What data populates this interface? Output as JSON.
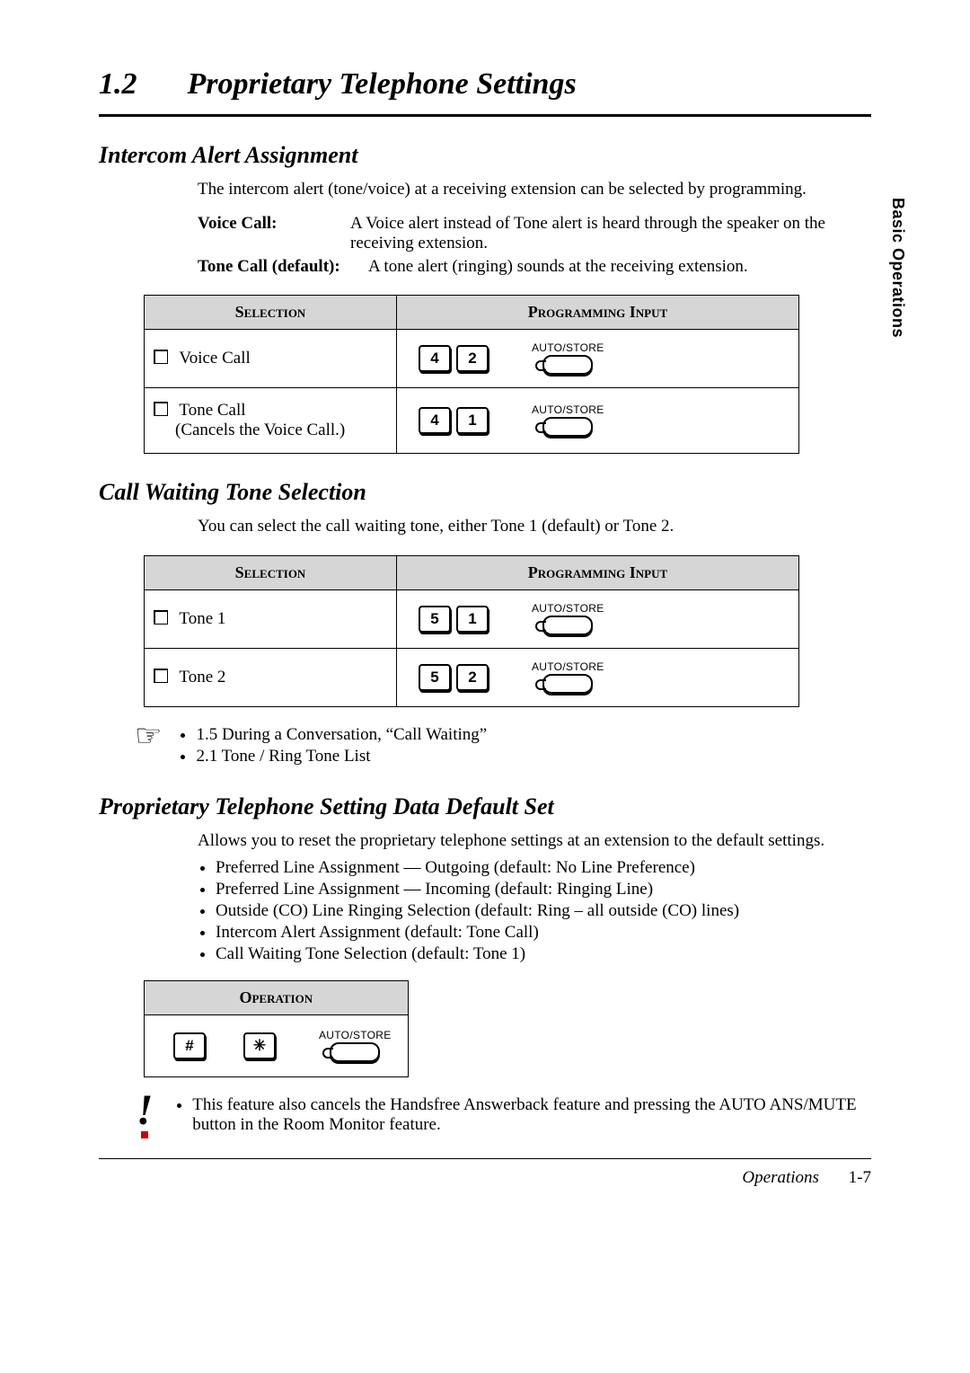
{
  "side_tab": "Basic Operations",
  "chapter": {
    "num": "1.2",
    "title": "Proprietary Telephone Settings"
  },
  "s1": {
    "heading": "Intercom Alert Assignment",
    "intro": "The intercom alert (tone/voice) at a receiving extension can be selected by programming.",
    "voice_k": "Voice Call:",
    "voice_v": "A Voice alert instead of Tone alert is heard through the speaker on the receiving extension.",
    "tone_k": "Tone Call (default):",
    "tone_v": "A tone alert (ringing) sounds at the receiving extension.",
    "th1": "Selection",
    "th2": "Programming Input",
    "r1": {
      "label": "Voice Call",
      "keys": [
        "4",
        "2"
      ],
      "auto": "AUTO/STORE"
    },
    "r2": {
      "label": "Tone Call",
      "sub": "(Cancels the Voice Call.)",
      "keys": [
        "4",
        "1"
      ],
      "auto": "AUTO/STORE"
    }
  },
  "s2": {
    "heading": "Call Waiting Tone Selection",
    "intro": "You can select the call waiting tone, either Tone 1 (default) or Tone 2.",
    "th1": "Selection",
    "th2": "Programming Input",
    "r1": {
      "label": "Tone 1",
      "keys": [
        "5",
        "1"
      ],
      "auto": "AUTO/STORE"
    },
    "r2": {
      "label": "Tone 2",
      "keys": [
        "5",
        "2"
      ],
      "auto": "AUTO/STORE"
    },
    "refs": [
      "1.5 During a Conversation, “Call Waiting”",
      "2.1 Tone / Ring Tone List"
    ]
  },
  "s3": {
    "heading": "Proprietary Telephone Setting Data Default Set",
    "intro": "Allows you to reset the proprietary telephone settings at an extension to the default settings.",
    "bullets": [
      "Preferred Line Assignment — Outgoing (default:  No Line Preference)",
      "Preferred Line Assignment — Incoming (default:  Ringing Line)",
      "Outside (CO) Line Ringing Selection (default:  Ring – all outside (CO) lines)",
      "Intercom Alert Assignment (default:  Tone Call)",
      "Call Waiting Tone Selection (default:  Tone 1)"
    ],
    "op_th": "Operation",
    "op_keys": [
      "#",
      "✳"
    ],
    "op_auto": "AUTO/STORE",
    "note": "This feature also cancels the Handsfree Answerback feature and pressing the AUTO ANS/MUTE button in the Room Monitor feature."
  },
  "footer": {
    "label": "Operations",
    "page": "1-7"
  }
}
